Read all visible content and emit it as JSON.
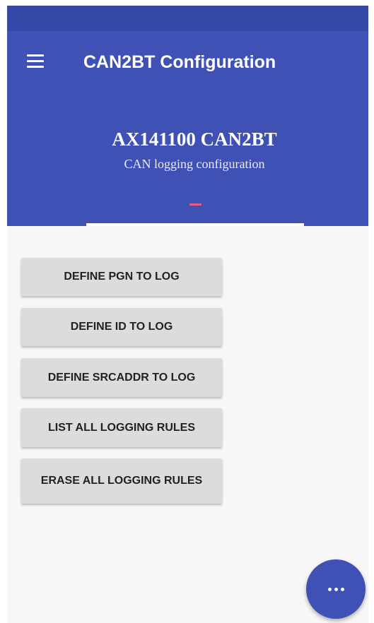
{
  "toolbar": {
    "title": "CAN2BT Configuration",
    "menu_icon": "hamburger-menu-icon"
  },
  "header": {
    "device_name": "AX141100 CAN2BT",
    "subtitle": "CAN logging configuration"
  },
  "actions": [
    {
      "label": "DEFINE PGN TO LOG"
    },
    {
      "label": "DEFINE ID TO LOG"
    },
    {
      "label": "DEFINE SRCADDR TO LOG"
    },
    {
      "label": "LIST ALL LOGGING RULES"
    },
    {
      "label": "ERASE ALL LOGGING RULES"
    }
  ],
  "fab": {
    "icon": "more-horizontal-icon"
  },
  "colors": {
    "primary": "#3f51b5",
    "primary_dark": "#3649a6",
    "accent": "#e85a86",
    "button_bg": "#dcdcdc",
    "background": "#f7f7f7"
  }
}
